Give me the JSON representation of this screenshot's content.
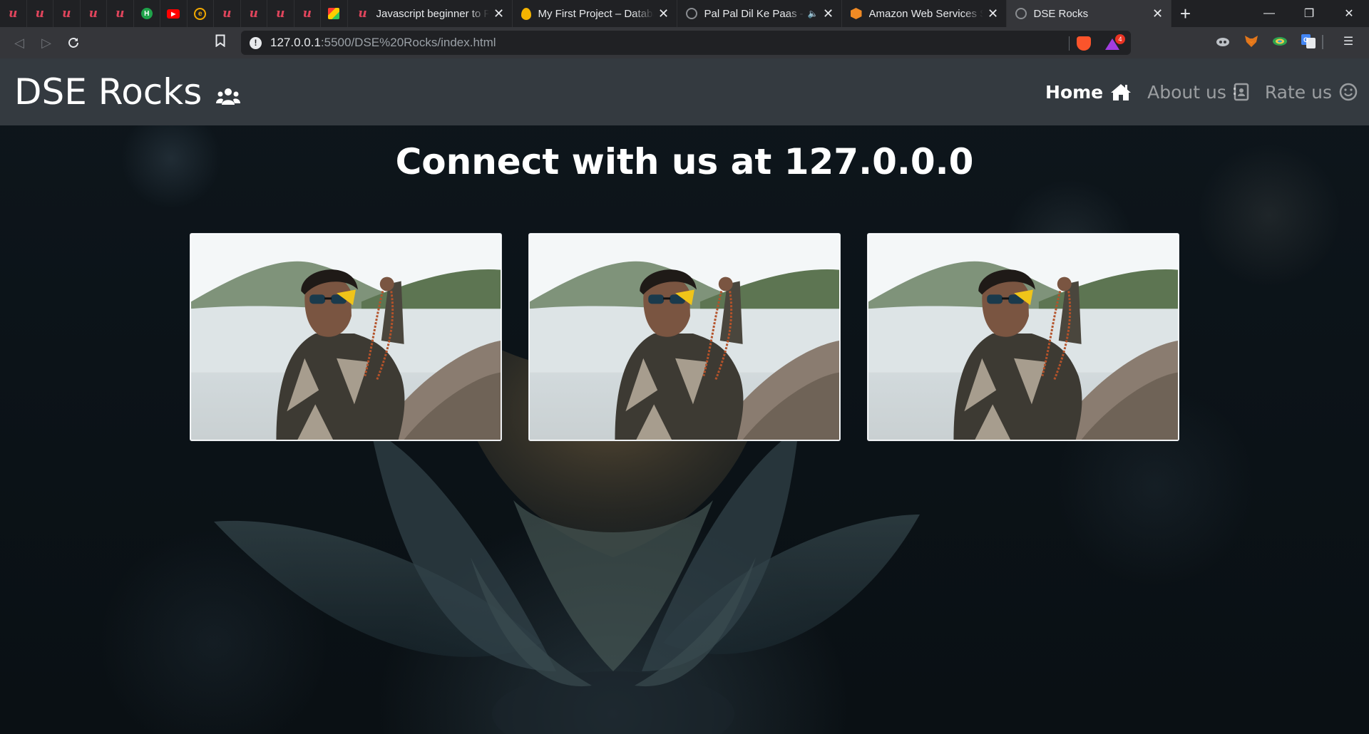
{
  "browser": {
    "pinned_tabs": [
      {
        "icon": "udemy-icon",
        "glyph": "u"
      },
      {
        "icon": "udemy-icon",
        "glyph": "u"
      },
      {
        "icon": "udemy-icon",
        "glyph": "u"
      },
      {
        "icon": "udemy-icon",
        "glyph": "u"
      },
      {
        "icon": "udemy-icon",
        "glyph": "u"
      },
      {
        "icon": "h-circle-icon",
        "glyph": "H"
      },
      {
        "icon": "youtube-icon",
        "glyph": "▶"
      },
      {
        "icon": "e-circle-icon",
        "glyph": "e"
      },
      {
        "icon": "udemy-icon",
        "glyph": "u"
      },
      {
        "icon": "udemy-icon",
        "glyph": "u"
      },
      {
        "icon": "udemy-icon",
        "glyph": "u"
      },
      {
        "icon": "udemy-icon",
        "glyph": "u"
      },
      {
        "icon": "colorful-cube-icon",
        "glyph": ""
      }
    ],
    "tabs": [
      {
        "title": "Javascript beginner to Pro",
        "icon": "udemy-icon"
      },
      {
        "title": "My First Project – Database",
        "icon": "firebase-icon"
      },
      {
        "title": "Pal Pal Dil Ke Paas - ",
        "icon": "globe-icon",
        "audio_icon": "speaker-icon"
      },
      {
        "title": "Amazon Web Services Sign-In",
        "icon": "aws-icon"
      },
      {
        "title": "DSE Rocks",
        "icon": "globe-icon",
        "active": true
      }
    ],
    "close_glyph": "✕",
    "new_tab_glyph": "+",
    "window_controls": {
      "minimize": "—",
      "restore": "❐",
      "close": "✕"
    },
    "url_host": "127.0.0.1",
    "url_rest": ":5500/DSE%20Rocks/index.html",
    "rewards_badge": "4",
    "info_glyph": "!"
  },
  "page": {
    "brand": "DSE Rocks",
    "nav": [
      {
        "label": "Home",
        "icon": "home-icon",
        "active": true
      },
      {
        "label": "About us",
        "icon": "contact-card-icon",
        "active": false
      },
      {
        "label": "Rate us",
        "icon": "smiley-icon",
        "active": false
      }
    ],
    "heading": "Connect with us at 127.0.0.0",
    "cards": [
      {
        "image": "man-holding-beads-photo"
      },
      {
        "image": "man-holding-beads-photo"
      },
      {
        "image": "man-holding-beads-photo"
      }
    ]
  },
  "colors": {
    "navbar": "#343a40",
    "page_bg": "#0a1116",
    "tab_bar": "#202124",
    "toolbar": "#35363a",
    "udemy": "#e0455c"
  }
}
